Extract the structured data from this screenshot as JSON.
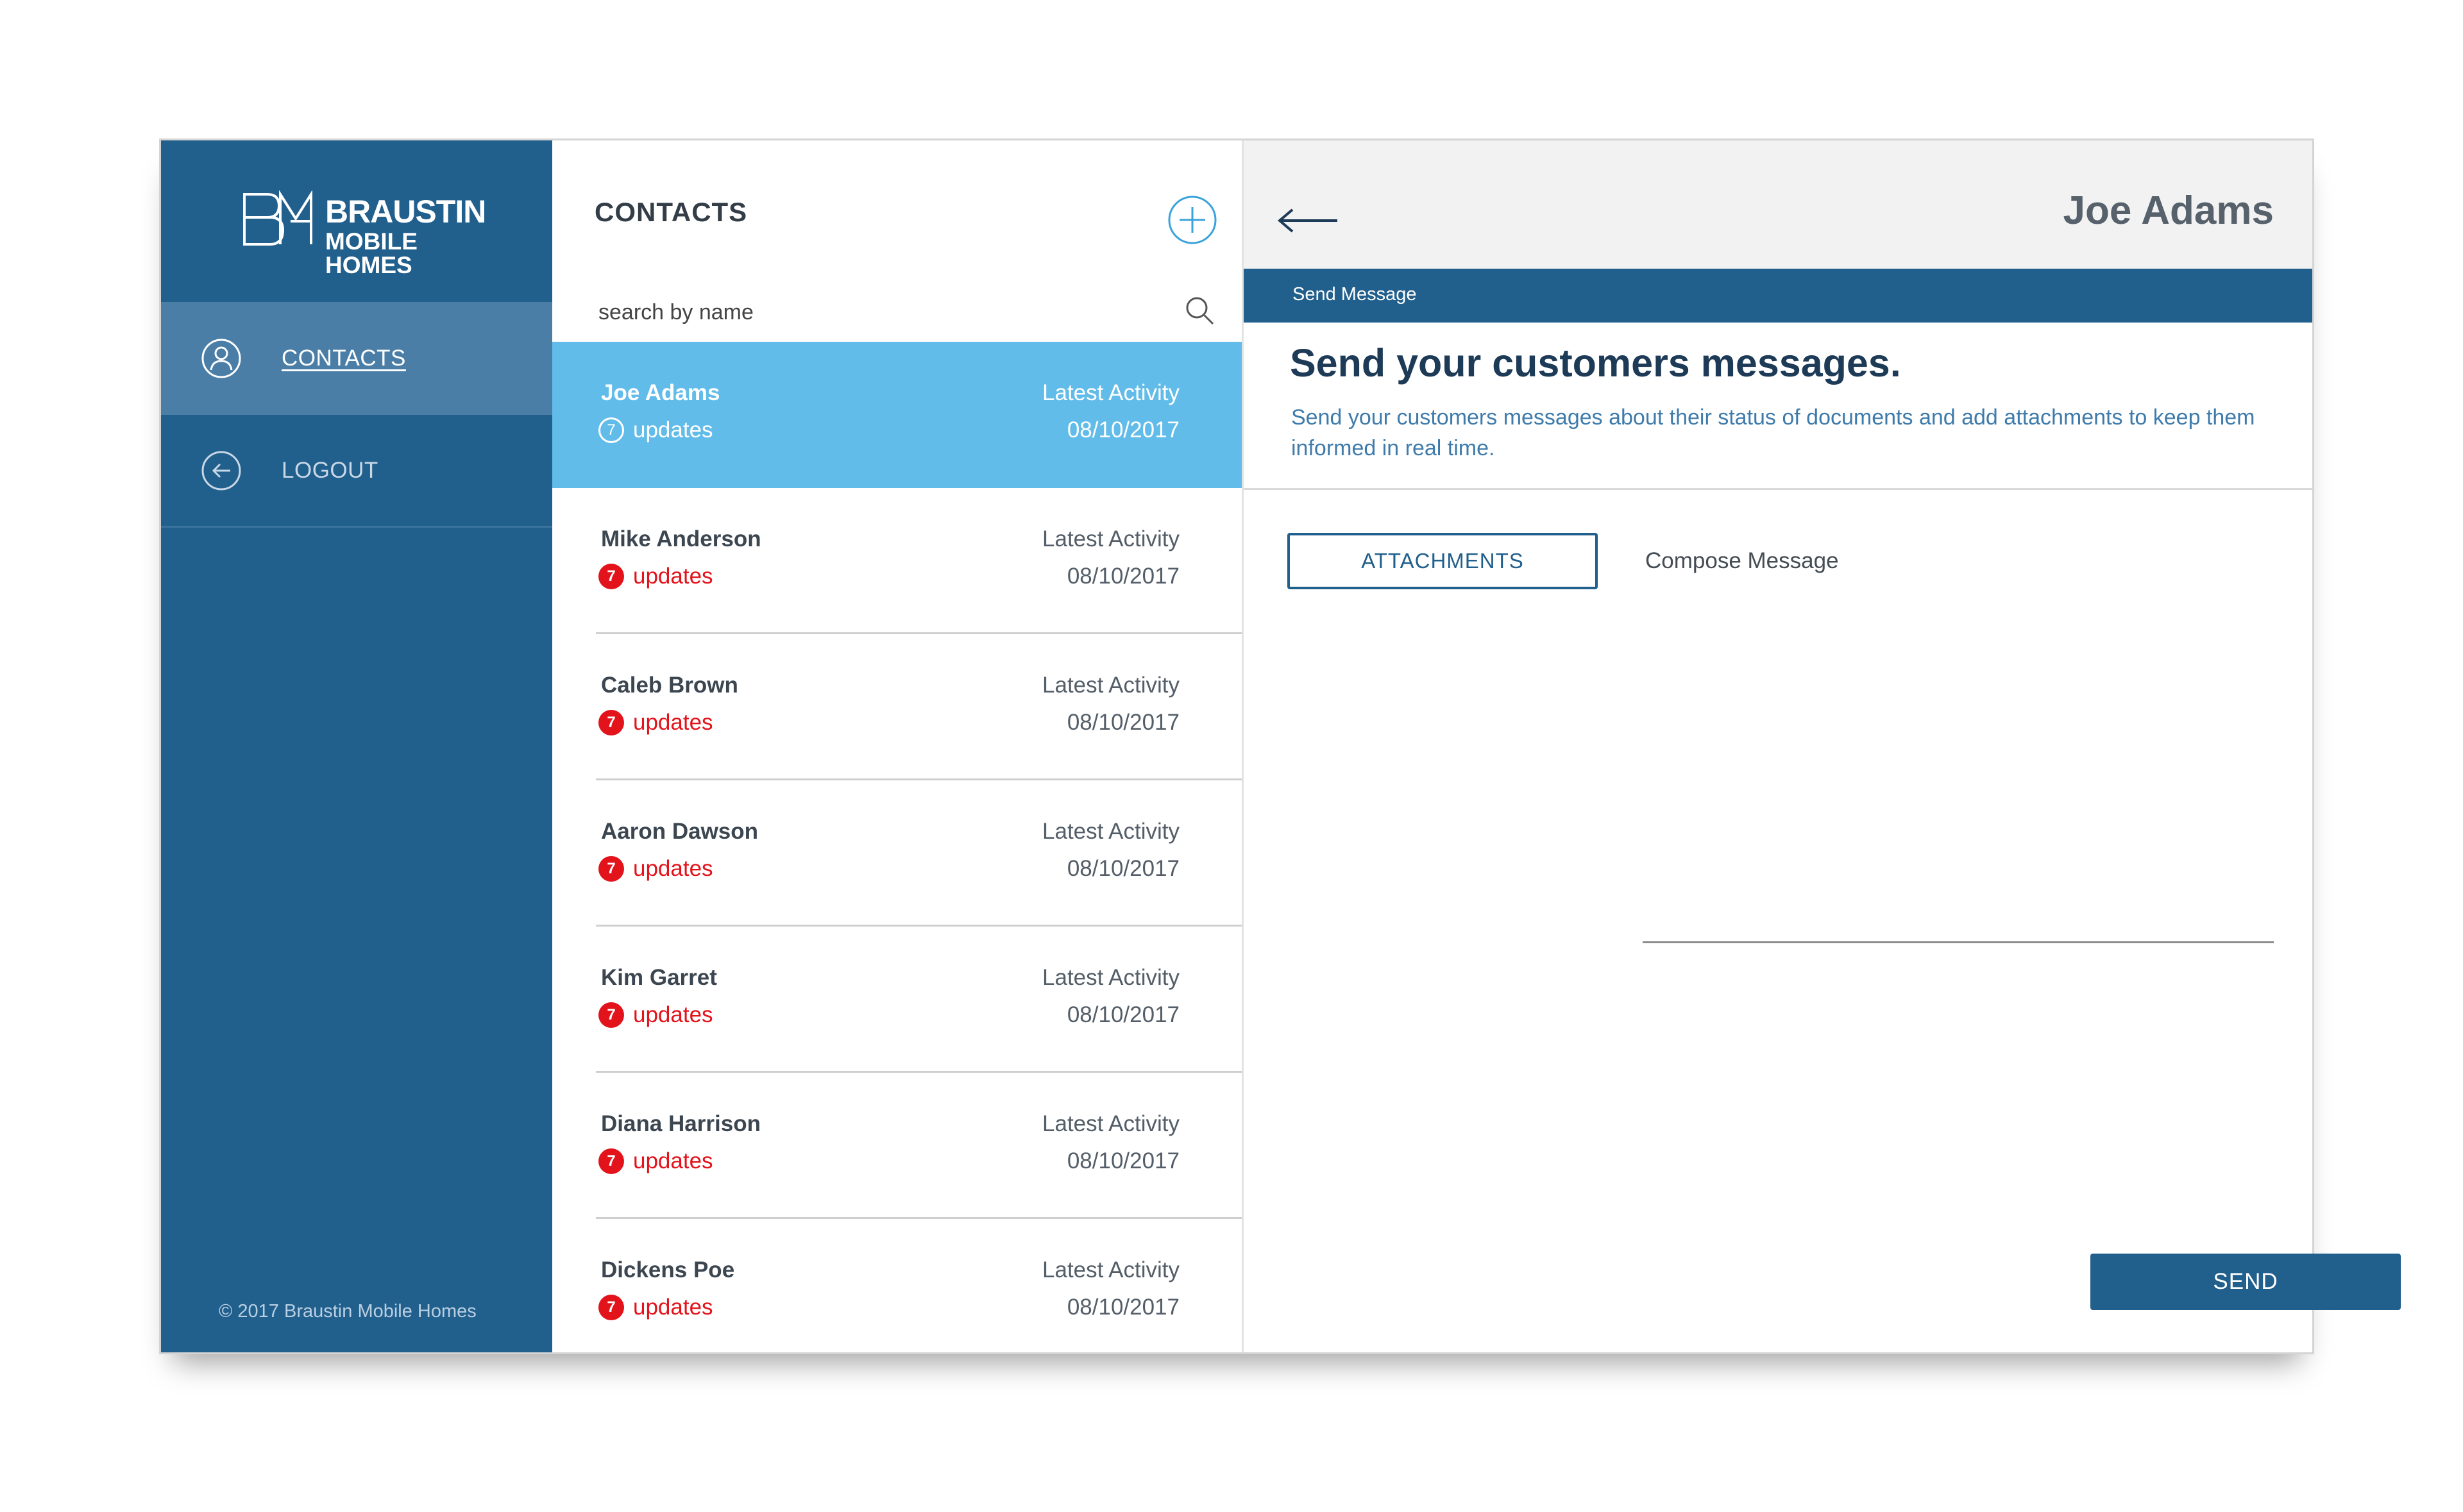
{
  "brand": {
    "line1": "BRAUSTIN",
    "line2": "MOBILE HOMES"
  },
  "sidebar": {
    "items": [
      {
        "label": "CONTACTS",
        "icon": "user-icon",
        "active": true
      },
      {
        "label": "LOGOUT",
        "icon": "arrow-left-circle-icon",
        "active": false
      }
    ],
    "copyright": "© 2017 Braustin Mobile Homes"
  },
  "contacts": {
    "title": "CONTACTS",
    "add_icon": "plus-circle-icon",
    "search": {
      "placeholder": "search by name",
      "value": "",
      "icon": "search-icon"
    },
    "items": [
      {
        "name": "Joe Adams",
        "updates_count": "7",
        "updates_label": "updates",
        "activity_label": "Latest Activity",
        "date": "08/10/2017",
        "selected": true
      },
      {
        "name": "Mike Anderson",
        "updates_count": "7",
        "updates_label": "updates",
        "activity_label": "Latest Activity",
        "date": "08/10/2017",
        "selected": false
      },
      {
        "name": "Caleb Brown",
        "updates_count": "7",
        "updates_label": "updates",
        "activity_label": "Latest Activity",
        "date": "08/10/2017",
        "selected": false
      },
      {
        "name": "Aaron Dawson",
        "updates_count": "7",
        "updates_label": "updates",
        "activity_label": "Latest Activity",
        "date": "08/10/2017",
        "selected": false
      },
      {
        "name": "Kim Garret",
        "updates_count": "7",
        "updates_label": "updates",
        "activity_label": "Latest Activity",
        "date": "08/10/2017",
        "selected": false
      },
      {
        "name": "Diana Harrison",
        "updates_count": "7",
        "updates_label": "updates",
        "activity_label": "Latest Activity",
        "date": "08/10/2017",
        "selected": false
      },
      {
        "name": "Dickens Poe",
        "updates_count": "7",
        "updates_label": "updates",
        "activity_label": "Latest Activity",
        "date": "08/10/2017",
        "selected": false
      }
    ]
  },
  "detail": {
    "back_icon": "arrow-left-icon",
    "contact_name": "Joe Adams",
    "section_label": "Send Message",
    "headline": "Send your customers messages.",
    "subtext": "Send your customers messages about their status of documents and add attachments to keep them informed in real time.",
    "attachments_label": "ATTACHMENTS",
    "compose_label": "Compose Message",
    "compose_value": "",
    "send_label": "SEND"
  },
  "colors": {
    "primary": "#215f8c",
    "sidebar_active": "#4a7ea7",
    "selected_row": "#62bce9",
    "alert": "#e3131b",
    "headline": "#1d3a57"
  }
}
